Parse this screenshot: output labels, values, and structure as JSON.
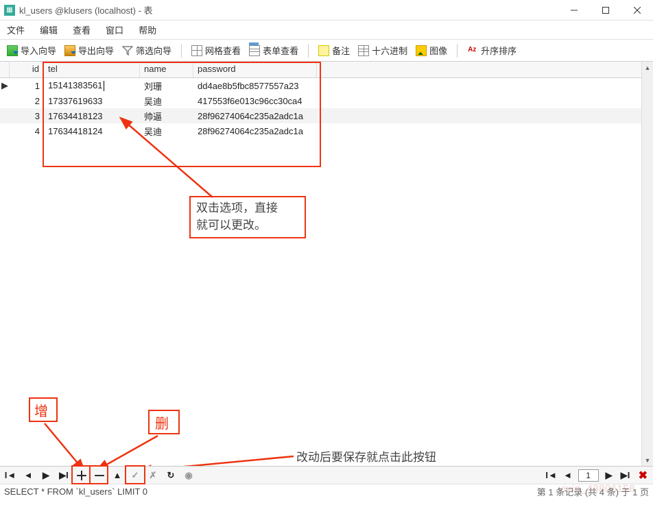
{
  "window": {
    "title": "kl_users @klusers (localhost) - 表"
  },
  "menu": {
    "file": "文件",
    "edit": "编辑",
    "view": "查看",
    "window": "窗口",
    "help": "帮助"
  },
  "toolbar": {
    "import_wizard": "导入向导",
    "export_wizard": "导出向导",
    "filter_wizard": "筛选向导",
    "grid_view": "网格查看",
    "form_view": "表单查看",
    "note": "备注",
    "hex": "十六进制",
    "image": "图像",
    "sort": "升序排序",
    "sort_icon": "Aᴢ"
  },
  "columns": {
    "id": "id",
    "tel": "tel",
    "name": "name",
    "password": "password"
  },
  "rows": [
    {
      "id": "1",
      "tel": "15141383561",
      "name": "刘珊",
      "password": "dd4ae8b5fbc8577557a23"
    },
    {
      "id": "2",
      "tel": "17337619633",
      "name": "吴迪",
      "password": "417553f6e013c96cc30ca4"
    },
    {
      "id": "3",
      "tel": "17634418123",
      "name": "帅逼",
      "password": "28f96274064c235a2adc1a"
    },
    {
      "id": "4",
      "tel": "17634418124",
      "name": "吴迪",
      "password": "28f96274064c235a2adc1a"
    }
  ],
  "annotations": {
    "tip_line1": "双击选项，直接",
    "tip_line2": "就可以更改。",
    "add": "增",
    "del": "删",
    "save_tip": "改动后要保存就点击此按钮"
  },
  "nav": {
    "page_value": "1"
  },
  "status": {
    "sql": "SELECT * FROM `kl_users` LIMIT 0",
    "record": "第 1 条记录 (共 4 条) 于 1 页"
  },
  "watermark": "yixin_43806158"
}
